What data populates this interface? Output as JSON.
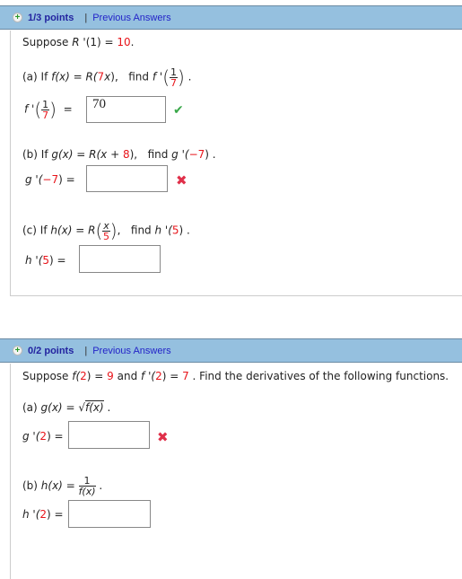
{
  "q1": {
    "header": {
      "points": "1/3 points",
      "separator": "|",
      "link": "Previous Answers"
    },
    "intro": {
      "prefix": "Suppose ",
      "fname": "R",
      "mid": " '(1) = ",
      "value": "10",
      "suffix": "."
    },
    "a": {
      "label": "(a) If ",
      "f": "f(x)",
      "eq": " = ",
      "R": "R(",
      "coef": "7",
      "x": "x",
      "close": "),",
      "find": "find ",
      "fp": "f '",
      "frac_num": "1",
      "frac_den": "7",
      "answer_label": "f '",
      "answer_value": "70",
      "status": "correct"
    },
    "b": {
      "label": "(b) If ",
      "g": "g(x)",
      "eq": " = ",
      "R": "R(x + ",
      "c": "8",
      "close": "),",
      "find": "find ",
      "gp": "g '(",
      "arg": "−7",
      "end": ") .",
      "answer_label": "g '(",
      "answer_arg": "−7",
      "answer_end": ")  =",
      "answer_value": "",
      "status": "incorrect"
    },
    "c": {
      "label": "(c) If ",
      "h": "h(x)",
      "eq": " = R",
      "frac_num": "x",
      "frac_den": "5",
      "close": ",",
      "find": "find ",
      "hp": "h '(",
      "arg": "5",
      "end": ") .",
      "answer_label": "h '(",
      "answer_arg": "5",
      "answer_end": ")  =",
      "answer_value": ""
    }
  },
  "q2": {
    "header": {
      "points": "0/2 points",
      "separator": "|",
      "link": "Previous Answers"
    },
    "intro": {
      "prefix": "Suppose  ",
      "f": "f(",
      "a1": "2",
      "m1": ") = ",
      "v1": "9",
      "m2": " and ",
      "fp": "f '(",
      "a2": "2",
      "m3": ") = ",
      "v2": "7",
      "suffix": " . Find the derivatives of the following functions."
    },
    "a": {
      "label": "(a)  ",
      "g": "g(x)",
      "eq": " = ",
      "radicand": "f(x)",
      "end": " .",
      "answer_label": "g '(",
      "answer_arg": "2",
      "answer_end": ") =",
      "answer_value": "",
      "status": "incorrect"
    },
    "b": {
      "label": "(b)  ",
      "h": "h(x)",
      "eq": " = ",
      "frac_num": "1",
      "frac_den": "f(x)",
      "end": " .",
      "answer_label": "h '(",
      "answer_arg": "2",
      "answer_end": ") =",
      "answer_value": ""
    }
  }
}
